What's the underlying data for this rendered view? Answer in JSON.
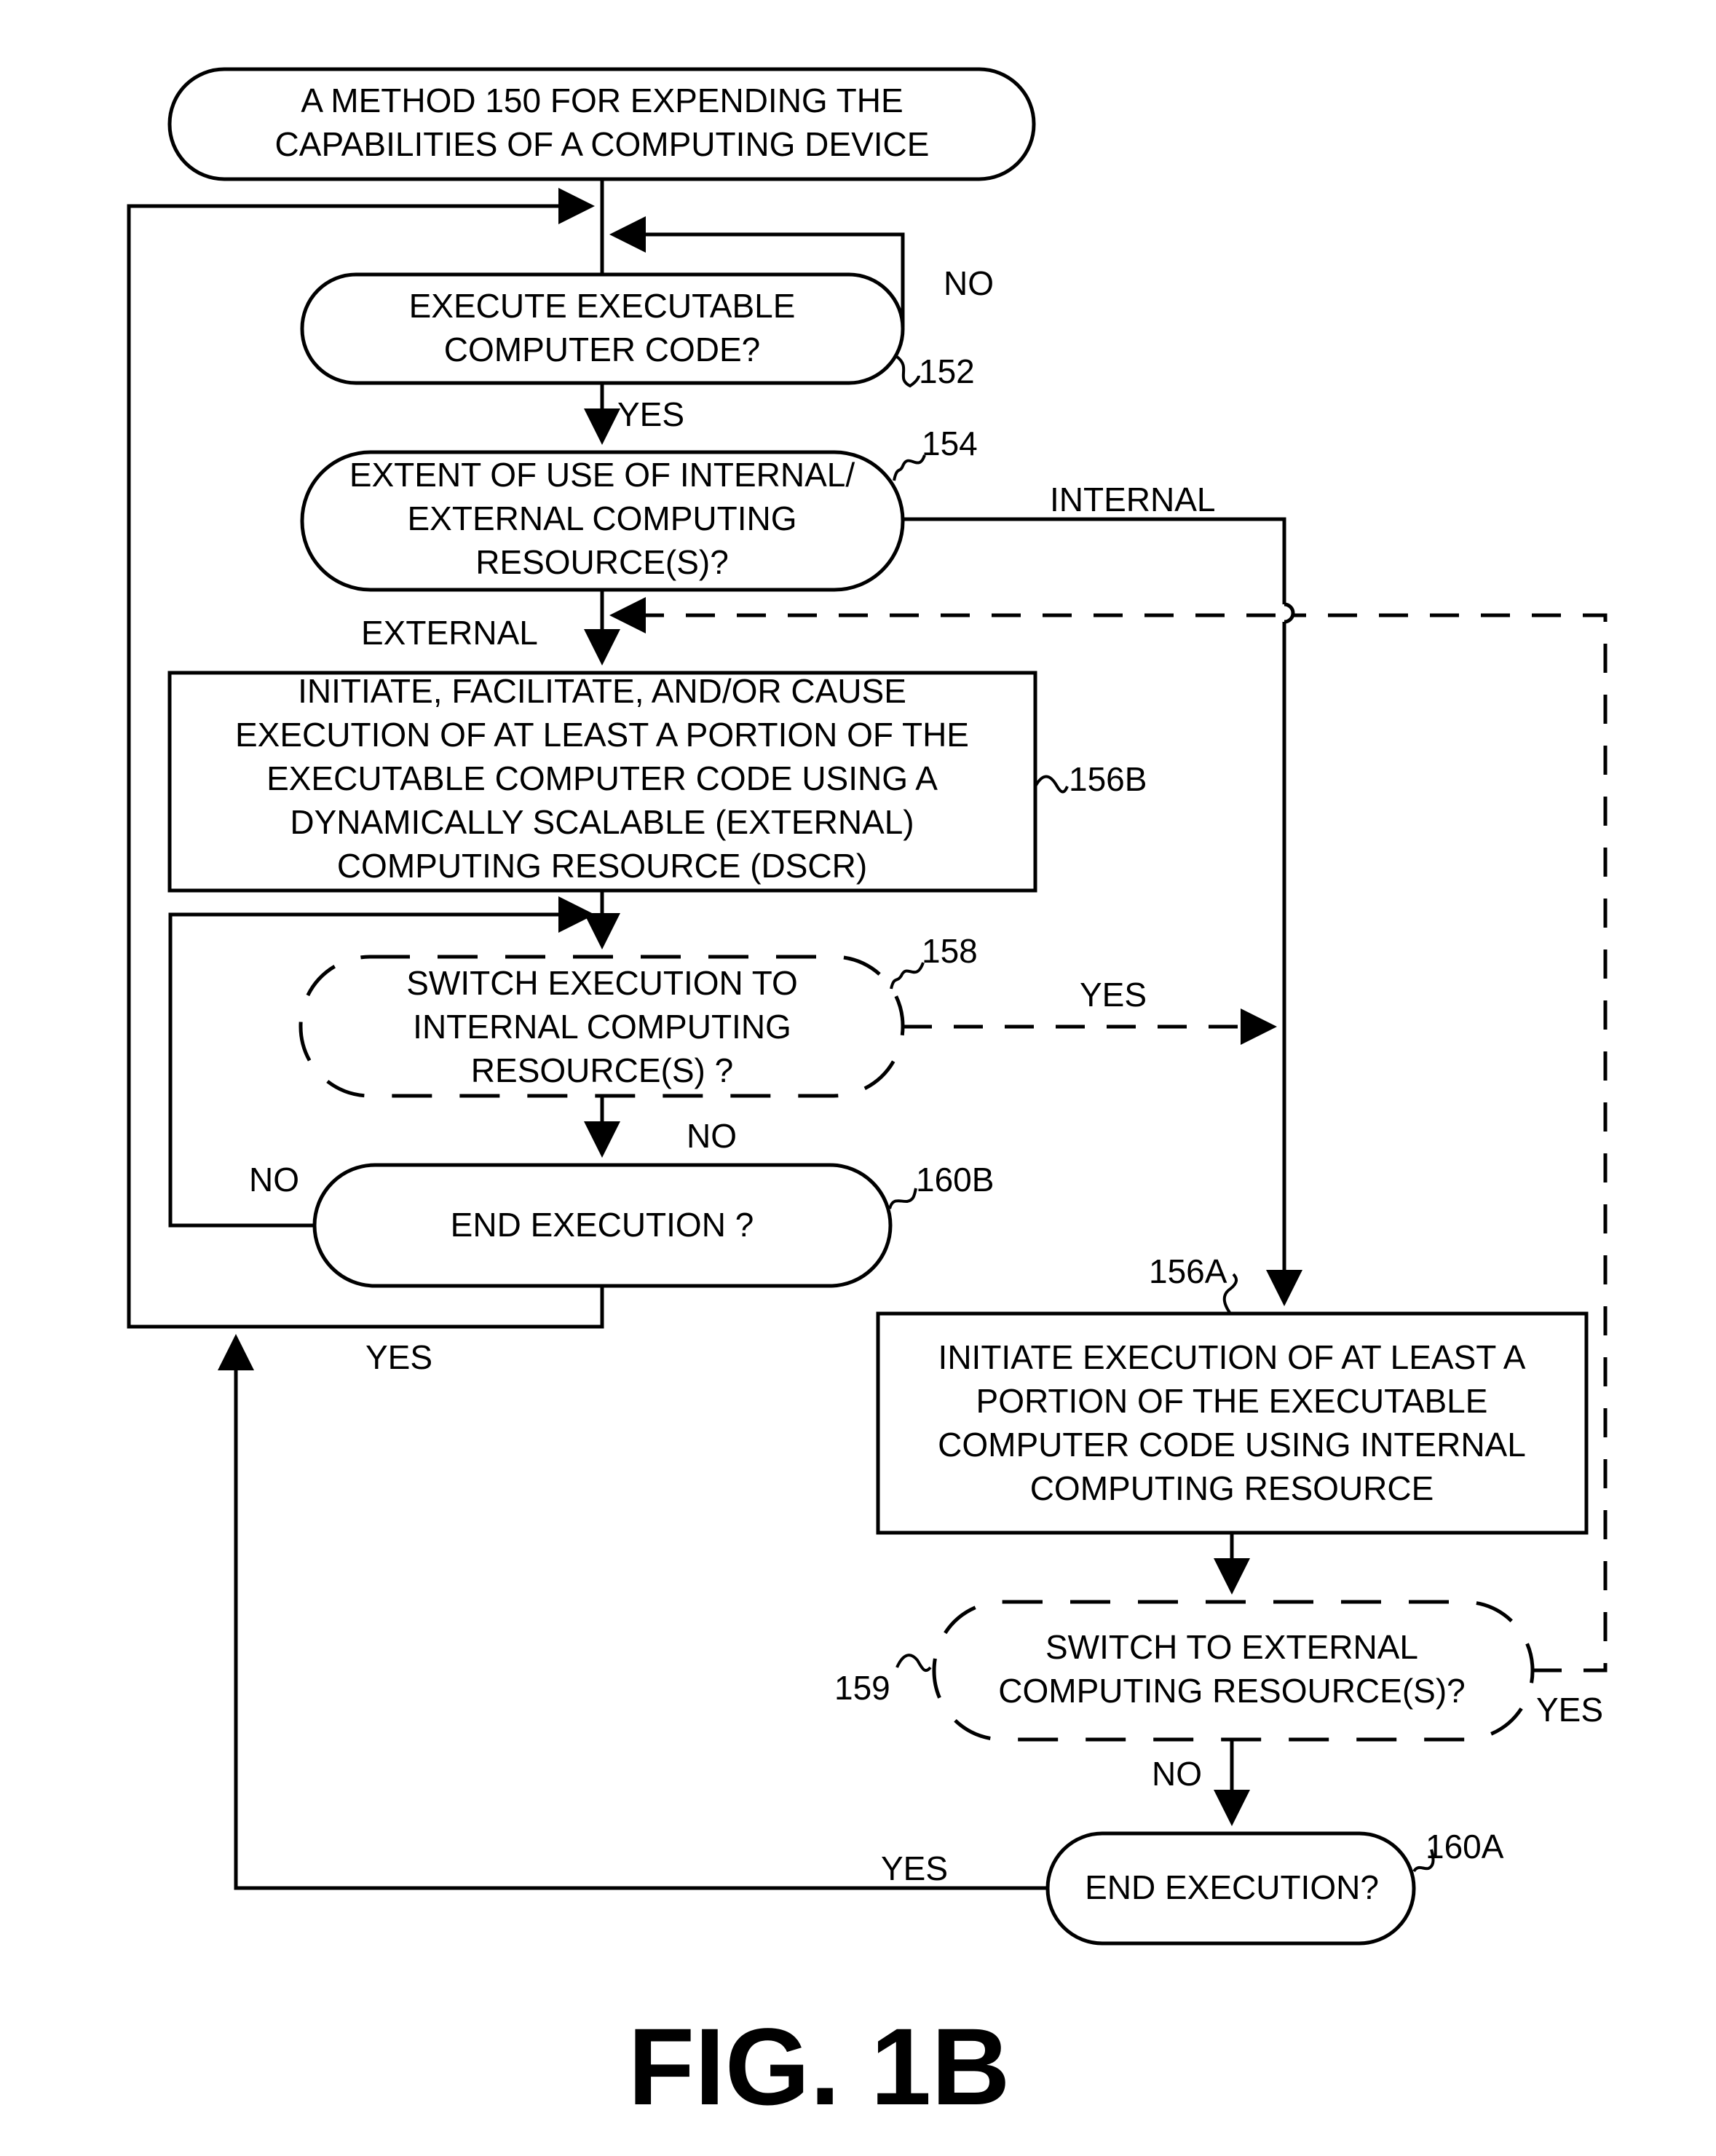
{
  "figure": {
    "caption": "FIG. 1B",
    "colors": {
      "stroke": "#000000",
      "background": "#ffffff"
    }
  },
  "nodes": {
    "start": {
      "shape": "terminator",
      "lines": [
        "A METHOD 150 FOR EXPENDING THE",
        "CAPABILITIES OF A COMPUTING DEVICE"
      ]
    },
    "n152": {
      "ref": "152",
      "shape": "decision-rounded",
      "lines": [
        "EXECUTE EXECUTABLE",
        "COMPUTER CODE?"
      ]
    },
    "n154": {
      "ref": "154",
      "shape": "decision-rounded",
      "lines": [
        "EXTENT OF USE OF INTERNAL/",
        "EXTERNAL COMPUTING",
        "RESOURCE(S)?"
      ]
    },
    "n156B": {
      "ref": "156B",
      "shape": "process",
      "lines": [
        "INITIATE, FACILITATE, AND/OR CAUSE",
        "EXECUTION OF AT LEAST A PORTION OF THE",
        "EXECUTABLE COMPUTER CODE USING A",
        "DYNAMICALLY SCALABLE (EXTERNAL)",
        "COMPUTING RESOURCE (DSCR)"
      ]
    },
    "n158": {
      "ref": "158",
      "shape": "decision-rounded-dashed",
      "lines": [
        "SWITCH EXECUTION TO",
        "INTERNAL COMPUTING",
        "RESOURCE(S) ?"
      ]
    },
    "n160B": {
      "ref": "160B",
      "shape": "decision-rounded",
      "lines": [
        "END EXECUTION ?"
      ]
    },
    "n156A": {
      "ref": "156A",
      "shape": "process",
      "lines": [
        "INITIATE  EXECUTION OF AT LEAST A",
        "PORTION OF THE EXECUTABLE",
        "COMPUTER CODE USING INTERNAL",
        "COMPUTING RESOURCE"
      ]
    },
    "n159": {
      "ref": "159",
      "shape": "decision-rounded-dashed",
      "lines": [
        "SWITCH TO EXTERNAL",
        "COMPUTING RESOURCE(S)?"
      ]
    },
    "n160A": {
      "ref": "160A",
      "shape": "decision-rounded",
      "lines": [
        "END EXECUTION?"
      ]
    }
  },
  "edge_labels": {
    "n152_no": "NO",
    "n152_yes": "YES",
    "n154_internal": "INTERNAL",
    "n154_external": "EXTERNAL",
    "n158_yes": "YES",
    "n158_no": "NO",
    "n160B_no": "NO",
    "n160B_yes": "YES",
    "n159_yes": "YES",
    "n159_no": "NO",
    "n160A_yes": "YES"
  },
  "edges": [
    {
      "from": "start",
      "to": "n152"
    },
    {
      "from": "n152",
      "to": "n152",
      "label": "NO"
    },
    {
      "from": "n152",
      "to": "n154",
      "label": "YES"
    },
    {
      "from": "n154",
      "to": "n156B",
      "label": "EXTERNAL"
    },
    {
      "from": "n154",
      "to": "n156A",
      "label": "INTERNAL"
    },
    {
      "from": "n156B",
      "to": "n158"
    },
    {
      "from": "n158",
      "to": "n156A",
      "label": "YES",
      "style": "dashed"
    },
    {
      "from": "n158",
      "to": "n160B",
      "label": "NO"
    },
    {
      "from": "n160B",
      "to": "n158",
      "label": "NO"
    },
    {
      "from": "n160B",
      "to": "n152",
      "label": "YES"
    },
    {
      "from": "n156A",
      "to": "n159"
    },
    {
      "from": "n159",
      "to": "n156B",
      "label": "YES",
      "style": "dashed"
    },
    {
      "from": "n159",
      "to": "n160A",
      "label": "NO"
    },
    {
      "from": "n160A",
      "to": "n152",
      "label": "YES"
    }
  ]
}
